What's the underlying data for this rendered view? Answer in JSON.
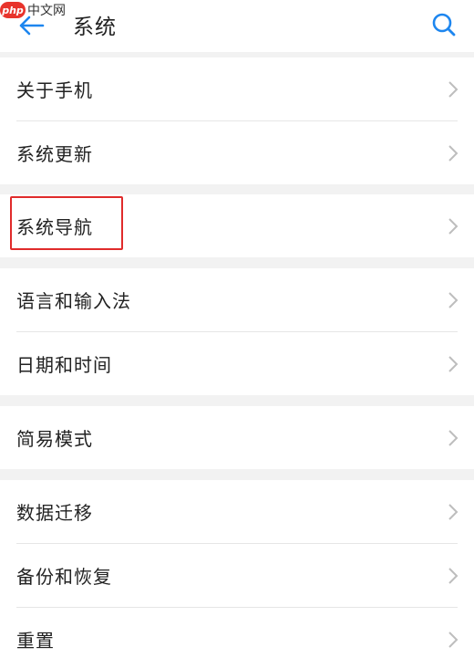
{
  "watermark": {
    "logo": "php",
    "text": "中文网"
  },
  "header": {
    "title": "系统",
    "back_icon": "arrow-left-icon",
    "search_icon": "search-icon"
  },
  "colors": {
    "accent": "#1d86ef",
    "highlight": "#e02b2b",
    "section_bg": "#f2f2f2",
    "chevron": "#bdbdbd"
  },
  "groups": [
    {
      "items": [
        {
          "label": "关于手机"
        },
        {
          "label": "系统更新"
        }
      ]
    },
    {
      "items": [
        {
          "label": "系统导航"
        }
      ]
    },
    {
      "items": [
        {
          "label": "语言和输入法"
        },
        {
          "label": "日期和时间"
        }
      ]
    },
    {
      "items": [
        {
          "label": "简易模式"
        }
      ]
    },
    {
      "items": [
        {
          "label": "数据迁移"
        },
        {
          "label": "备份和恢复"
        },
        {
          "label": "重置"
        }
      ]
    }
  ],
  "highlighted_item": "系统导航"
}
